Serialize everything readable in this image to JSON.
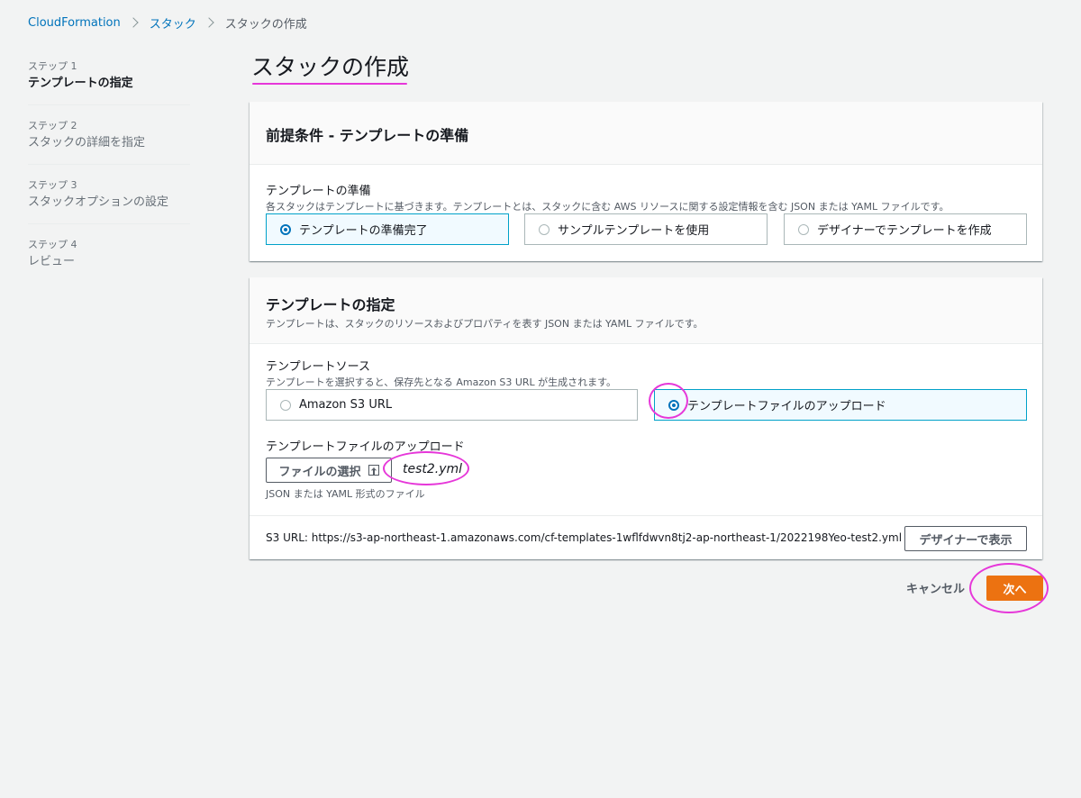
{
  "breadcrumb": {
    "items": [
      "CloudFormation",
      "スタック",
      "スタックの作成"
    ]
  },
  "steps": [
    {
      "num": "ステップ 1",
      "name": "テンプレートの指定",
      "active": true
    },
    {
      "num": "ステップ 2",
      "name": "スタックの詳細を指定",
      "active": false
    },
    {
      "num": "ステップ 3",
      "name": "スタックオプションの設定",
      "active": false
    },
    {
      "num": "ステップ 4",
      "name": "レビュー",
      "active": false
    }
  ],
  "page_title": "スタックの作成",
  "prereq": {
    "title": "前提条件 - テンプレートの準備",
    "field_label": "テンプレートの準備",
    "field_desc": "各スタックはテンプレートに基づきます。テンプレートとは、スタックに含む AWS リソースに関する設定情報を含む JSON または YAML ファイルです。",
    "options": [
      {
        "label": "テンプレートの準備完了",
        "selected": true
      },
      {
        "label": "サンプルテンプレートを使用",
        "selected": false
      },
      {
        "label": "デザイナーでテンプレートを作成",
        "selected": false
      }
    ]
  },
  "specify": {
    "title": "テンプレートの指定",
    "desc": "テンプレートは、スタックのリソースおよびプロパティを表す JSON または YAML ファイルです。",
    "source_label": "テンプレートソース",
    "source_desc": "テンプレートを選択すると、保存先となる Amazon S3 URL が生成されます。",
    "source_options": [
      {
        "label": "Amazon S3 URL",
        "selected": false
      },
      {
        "label": "テンプレートファイルのアップロード",
        "selected": true
      }
    ],
    "upload_label": "テンプレートファイルのアップロード",
    "choose_file_label": "ファイルの選択",
    "file_name": "test2.yml",
    "upload_hint": "JSON または YAML 形式のファイル",
    "s3_url_label": "S3 URL:",
    "s3_url": "https://s3-ap-northeast-1.amazonaws.com/cf-templates-1wflfdwvn8tj2-ap-northeast-1/2022198Yeo-test2.yml",
    "designer_button": "デザイナーで表示"
  },
  "footer": {
    "cancel": "キャンセル",
    "next": "次へ"
  },
  "colors": {
    "primary": "#ec7211",
    "link": "#0073bb",
    "selected_border": "#00a1c9",
    "annotation": "#e637d9"
  }
}
